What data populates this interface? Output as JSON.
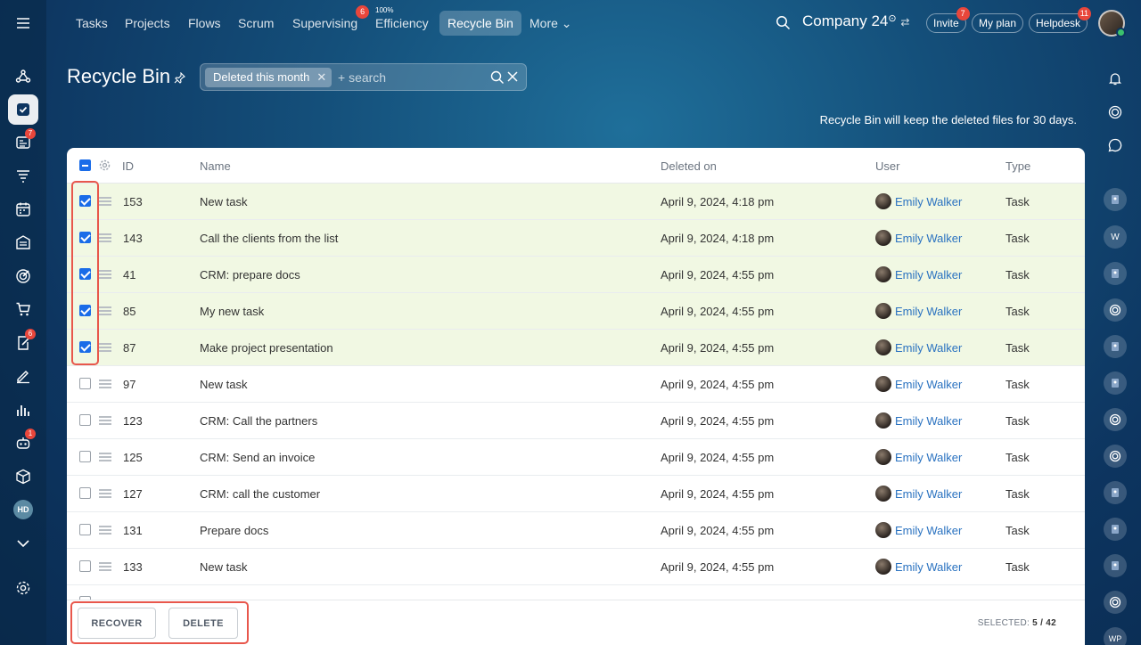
{
  "topbar": {
    "tabs": [
      {
        "label": "Tasks"
      },
      {
        "label": "Projects"
      },
      {
        "label": "Flows"
      },
      {
        "label": "Scrum"
      },
      {
        "label": "Supervising",
        "badge": "6"
      },
      {
        "label": "Efficiency",
        "super": "100%"
      },
      {
        "label": "Recycle Bin",
        "active": true
      },
      {
        "label": "More ⌄"
      }
    ],
    "company": "Company 24",
    "invite_label": "Invite",
    "invite_badge": "7",
    "my_plan_label": "My plan",
    "helpdesk_label": "Helpdesk",
    "helpdesk_badge": "11"
  },
  "left_rail": {
    "icons": [
      "menu-icon",
      "network-icon",
      "tasks-icon",
      "feed-icon",
      "funnel-icon",
      "calendar-icon",
      "building-icon",
      "target-icon",
      "cart-icon",
      "doc-edit-icon",
      "sign-icon",
      "chart-icon",
      "robot-icon",
      "box-icon",
      "avatar-hd",
      "chevron-down-icon",
      "gear-icon"
    ],
    "badges": {
      "feed": "7",
      "doc": "6",
      "robot": "1"
    },
    "avatar_initials": "HD"
  },
  "header": {
    "title": "Recycle Bin",
    "filter_chip": "Deleted this month",
    "search_placeholder": "+ search",
    "info_note": "Recycle Bin will keep the deleted files for 30 days."
  },
  "table": {
    "columns": {
      "id": "ID",
      "name": "Name",
      "deleted_on": "Deleted on",
      "user": "User",
      "type": "Type"
    },
    "rows": [
      {
        "selected": true,
        "id": "153",
        "name": "New task",
        "deleted_on": "April 9, 2024, 4:18 pm",
        "user": "Emily Walker",
        "type": "Task"
      },
      {
        "selected": true,
        "id": "143",
        "name": "Call the clients from the list",
        "deleted_on": "April 9, 2024, 4:18 pm",
        "user": "Emily Walker",
        "type": "Task"
      },
      {
        "selected": true,
        "id": "41",
        "name": "CRM: prepare docs",
        "deleted_on": "April 9, 2024, 4:55 pm",
        "user": "Emily Walker",
        "type": "Task"
      },
      {
        "selected": true,
        "id": "85",
        "name": "My new task",
        "deleted_on": "April 9, 2024, 4:55 pm",
        "user": "Emily Walker",
        "type": "Task"
      },
      {
        "selected": true,
        "id": "87",
        "name": "Make project presentation",
        "deleted_on": "April 9, 2024, 4:55 pm",
        "user": "Emily Walker",
        "type": "Task"
      },
      {
        "selected": false,
        "id": "97",
        "name": "New task",
        "deleted_on": "April 9, 2024, 4:55 pm",
        "user": "Emily Walker",
        "type": "Task"
      },
      {
        "selected": false,
        "id": "123",
        "name": "CRM: Call the partners",
        "deleted_on": "April 9, 2024, 4:55 pm",
        "user": "Emily Walker",
        "type": "Task"
      },
      {
        "selected": false,
        "id": "125",
        "name": "CRM: Send an invoice",
        "deleted_on": "April 9, 2024, 4:55 pm",
        "user": "Emily Walker",
        "type": "Task"
      },
      {
        "selected": false,
        "id": "127",
        "name": "CRM: call the customer",
        "deleted_on": "April 9, 2024, 4:55 pm",
        "user": "Emily Walker",
        "type": "Task"
      },
      {
        "selected": false,
        "id": "131",
        "name": "Prepare docs",
        "deleted_on": "April 9, 2024, 4:55 pm",
        "user": "Emily Walker",
        "type": "Task"
      },
      {
        "selected": false,
        "id": "133",
        "name": "New task",
        "deleted_on": "April 9, 2024, 4:55 pm",
        "user": "Emily Walker",
        "type": "Task"
      }
    ]
  },
  "footer": {
    "recover_label": "RECOVER",
    "delete_label": "DELETE",
    "selected_label": "SELECTED:",
    "selected_value": "5 / 42"
  },
  "right_rail": {
    "icons": [
      "bell-icon",
      "copilot-icon",
      "chat-icon",
      "user-card-icon",
      "avatar-w",
      "user-card-icon",
      "copilot-icon",
      "user-card-icon",
      "user-card-icon",
      "copilot-icon",
      "copilot-icon",
      "user-card-icon",
      "user-card-icon",
      "user-card-icon",
      "copilot-icon",
      "avatar-wp"
    ],
    "avatar_w": "W",
    "avatar_wp": "WP"
  },
  "colors": {
    "accent": "#1a6ce8",
    "selected_row": "#f1f8e3",
    "highlight": "#e8574c",
    "link": "#2a72c0"
  }
}
